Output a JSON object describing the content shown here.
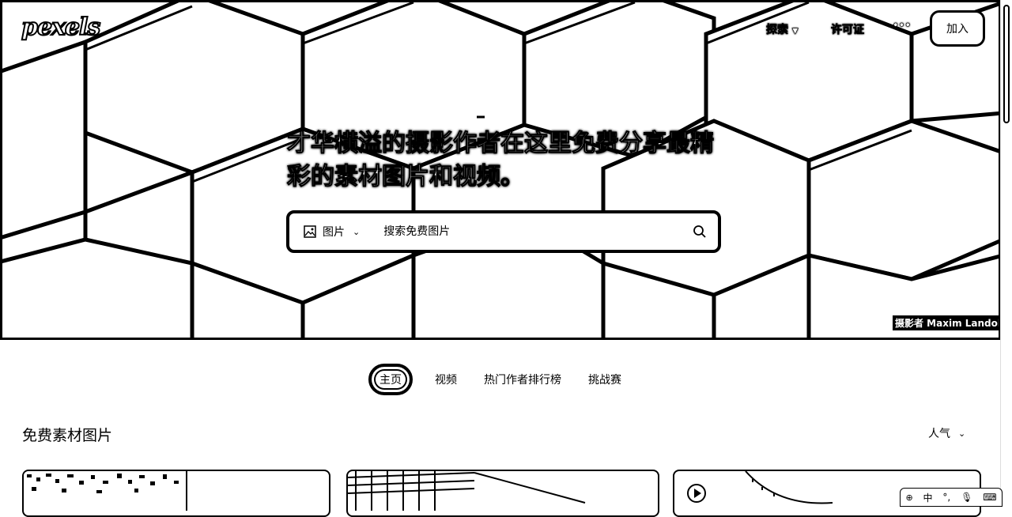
{
  "brand": {
    "logo_text": "pexels"
  },
  "nav": {
    "explore": "探索",
    "license": "许可证",
    "more": "•••",
    "join": "加入"
  },
  "hero": {
    "headline_line1": "才华横溢的摄影作者在这里免费分享最精",
    "headline_line2": "彩的素材图片和视频。",
    "search": {
      "type_label": "图片",
      "placeholder": "搜索免费图片"
    },
    "credit": "摄影者 Maxim Landolfi"
  },
  "tabs": [
    {
      "label": "主页",
      "active": true
    },
    {
      "label": "视频",
      "active": false
    },
    {
      "label": "热门作者排行榜",
      "active": false
    },
    {
      "label": "挑战赛",
      "active": false
    }
  ],
  "feed": {
    "title": "免费素材图片",
    "sort_label": "人气"
  },
  "system_tray": {
    "ime": "中"
  },
  "icons": [
    "image-icon",
    "chevron-down-icon",
    "search-icon",
    "more-icon",
    "play-icon",
    "mic-icon"
  ]
}
